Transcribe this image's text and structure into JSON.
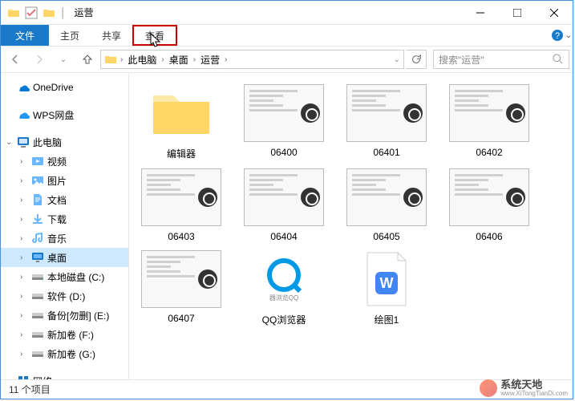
{
  "title": "运营",
  "tabs": {
    "file": "文件",
    "home": "主页",
    "share": "共享",
    "view": "查看"
  },
  "breadcrumb": {
    "segments": [
      "此电脑",
      "桌面",
      "运营"
    ]
  },
  "search": {
    "placeholder": "搜索\"运营\""
  },
  "sidebar": {
    "onedrive": "OneDrive",
    "wps": "WPS网盘",
    "thispc": "此电脑",
    "video": "视频",
    "pictures": "图片",
    "documents": "文档",
    "downloads": "下载",
    "music": "音乐",
    "desktop": "桌面",
    "drive_c": "本地磁盘 (C:)",
    "drive_d": "软件 (D:)",
    "drive_e": "备份[勿删] (E:)",
    "drive_f": "新加卷 (F:)",
    "drive_g": "新加卷 (G:)",
    "network": "网络"
  },
  "items": [
    {
      "label": "编辑器",
      "type": "folder"
    },
    {
      "label": "06400",
      "type": "video"
    },
    {
      "label": "06401",
      "type": "video"
    },
    {
      "label": "06402",
      "type": "video"
    },
    {
      "label": "06403",
      "type": "video"
    },
    {
      "label": "06404",
      "type": "video"
    },
    {
      "label": "06405",
      "type": "video"
    },
    {
      "label": "06406",
      "type": "video"
    },
    {
      "label": "06407",
      "type": "video"
    },
    {
      "label": "QQ浏览器",
      "type": "app"
    },
    {
      "label": "绘图1",
      "type": "doc"
    }
  ],
  "statusbar": {
    "count": "11 个项目"
  },
  "watermark": {
    "brand": "系统天地",
    "url": "www.XiTongTianDi.com"
  }
}
